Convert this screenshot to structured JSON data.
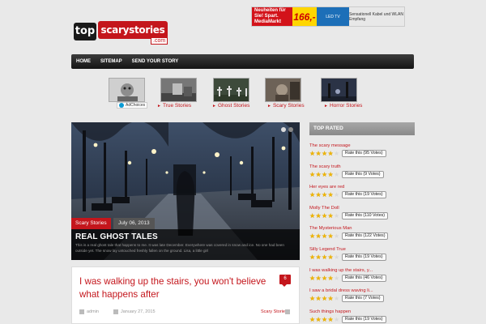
{
  "logo": {
    "word_top": "top",
    "word_main": "scarystories",
    "domain": ".com"
  },
  "banner": {
    "store": "Neuheiten für Sie! Spart. MediaMarkt",
    "price": "166,-",
    "product": "LED TV",
    "note": "Sensationell Kabel und WLAN Empfang"
  },
  "nav": {
    "items": [
      "Home",
      "Sitemap",
      "Send Your Story"
    ]
  },
  "ads": {
    "adchoices": "AdChoices",
    "links": [
      "True Stories",
      "Ghost Stories",
      "Scary Stories",
      "Horror Stories"
    ]
  },
  "slider": {
    "category": "Scary Stories",
    "date": "July 06, 2013",
    "title": "REAL GHOST TALES",
    "excerpt": "This is a real ghost tale that happens to me. It was late December. Everywhere was covered in snow and ice. No one had been outside yet. The snow lay untouched freshly fallen on the ground. Lisa, a little girl",
    "active_dot": 0
  },
  "post": {
    "title": "I was walking up the stairs, you won't believe what happens after",
    "comments": "6",
    "author": "admin",
    "date": "January 27, 2015",
    "category": "Scary Stories"
  },
  "sidebar": {
    "heading": "TOP RATED",
    "items": [
      {
        "title": "The scary message",
        "stars": 4,
        "votes": "Rate this (95 Votes)"
      },
      {
        "title": "The scary truth",
        "stars": 4,
        "votes": "Rate this (9 Votes)"
      },
      {
        "title": "Her eyes are red",
        "stars": 4,
        "votes": "Rate this (19 Votes)"
      },
      {
        "title": "Molly The Doll",
        "stars": 4,
        "votes": "Rate this (110 Votes)"
      },
      {
        "title": "The Mysterious Man",
        "stars": 4,
        "votes": "Rate this (122 Votes)"
      },
      {
        "title": "Silly Legend True",
        "stars": 4,
        "votes": "Rate this (19 Votes)"
      },
      {
        "title": "I was walking up the stairs, y...",
        "stars": 4,
        "votes": "Rate this (46 Votes)"
      },
      {
        "title": "I saw a bridal dress waving li...",
        "stars": 4,
        "votes": "Rate this (7 Votes)"
      },
      {
        "title": "Such things happen",
        "stars": 4,
        "votes": "Rate this (19 Votes)"
      }
    ]
  },
  "colors": {
    "accent": "#c4161c",
    "nav": "#1f1f1f",
    "sidebar_head": "#999999",
    "star": "#f0b400"
  }
}
